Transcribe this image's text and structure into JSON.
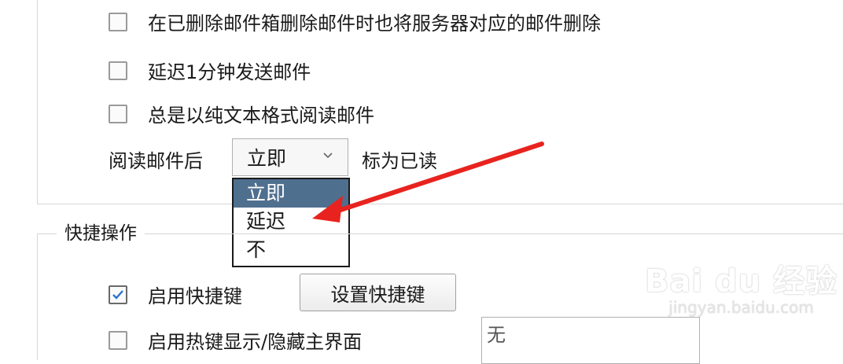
{
  "options": {
    "delete_server_label": "在已删除邮件箱删除邮件时也将服务器对应的邮件删除",
    "delay_send_label": "延迟1分钟发送邮件",
    "plain_text_label": "总是以纯文本格式阅读邮件"
  },
  "read_setting": {
    "prefix": "阅读邮件后",
    "selected": "立即",
    "suffix": "标为已读",
    "dropdown_options": [
      "立即",
      "延迟",
      "不"
    ]
  },
  "shortcut": {
    "group_title": "快捷操作",
    "enable_label": "启用快捷键",
    "enable_checked": true,
    "set_button": "设置快捷键",
    "hotkey_label": "启用热键显示/隐藏主界面",
    "hotkey_value": "无"
  },
  "watermark": {
    "logo": "Bai du 经验",
    "url": "jingyan.baidu.com"
  },
  "colors": {
    "selected_option_bg": "#4f6f8f",
    "arrow": "#e8231f"
  }
}
